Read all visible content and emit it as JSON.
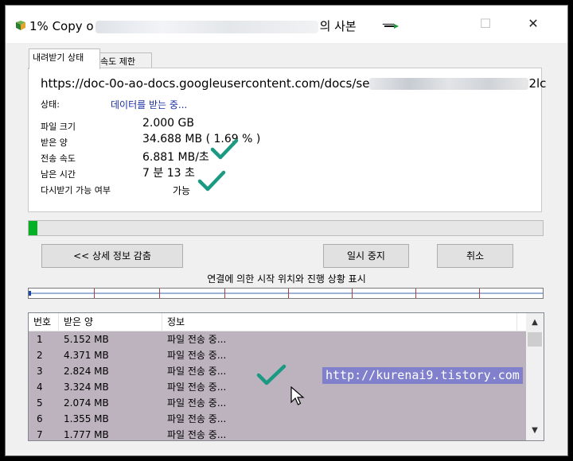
{
  "window": {
    "title_prefix": "1% Copy o",
    "title_suffix": "의 사본",
    "min_glyph": "—",
    "max_glyph": "☐",
    "close_glyph": "✕"
  },
  "tabs": [
    "내려받기 상태",
    "속도 제한"
  ],
  "download": {
    "url_prefix": "https://doc-0o-ao-docs.googleusercontent.com/docs/se",
    "url_suffix": "2lc",
    "status_label": "상태:",
    "status_value": "데이터를 받는 중...",
    "file_size_label": "파일 크기",
    "file_size_value": "2.000  GB",
    "received_label": "받은 양",
    "received_value": "34.688  MB  ( 1.69 % )",
    "speed_label": "전송 속도",
    "speed_value": "6.881  MB/초",
    "remaining_label": "남은 시간",
    "remaining_value": "7 분 13 초",
    "resume_label": "다시받기 가능 여부",
    "resume_value": "가능",
    "progress": 0.0169
  },
  "buttons": {
    "detail": "<< 상세 정보 감춤",
    "pause": "일시 중지",
    "cancel": "취소"
  },
  "connection_label": "연결에 의한 시작 위치와 진행 상황 표시",
  "list": {
    "headers": [
      "번호",
      "받은 양",
      "정보"
    ],
    "rows": [
      {
        "no": "1",
        "recv": "5.152  MB",
        "info": "파일 전송 중..."
      },
      {
        "no": "2",
        "recv": "4.371  MB",
        "info": "파일 전송 중..."
      },
      {
        "no": "3",
        "recv": "2.824  MB",
        "info": "파일 전송 중..."
      },
      {
        "no": "4",
        "recv": "3.324  MB",
        "info": "파일 전송 중..."
      },
      {
        "no": "5",
        "recv": "2.074  MB",
        "info": "파일 전송 중..."
      },
      {
        "no": "6",
        "recv": "1.355  MB",
        "info": "파일 전송 중..."
      },
      {
        "no": "7",
        "recv": "1.777  MB",
        "info": "파일 전송 중..."
      }
    ]
  },
  "watermark": "http://kurenai9.tistory.com",
  "colors": {
    "progress": "#06b025",
    "check": "#1a9a82",
    "status_text": "#1a2ea0",
    "rows_bg": "#bdb3bf",
    "watermark_bg": "#8080cc"
  }
}
